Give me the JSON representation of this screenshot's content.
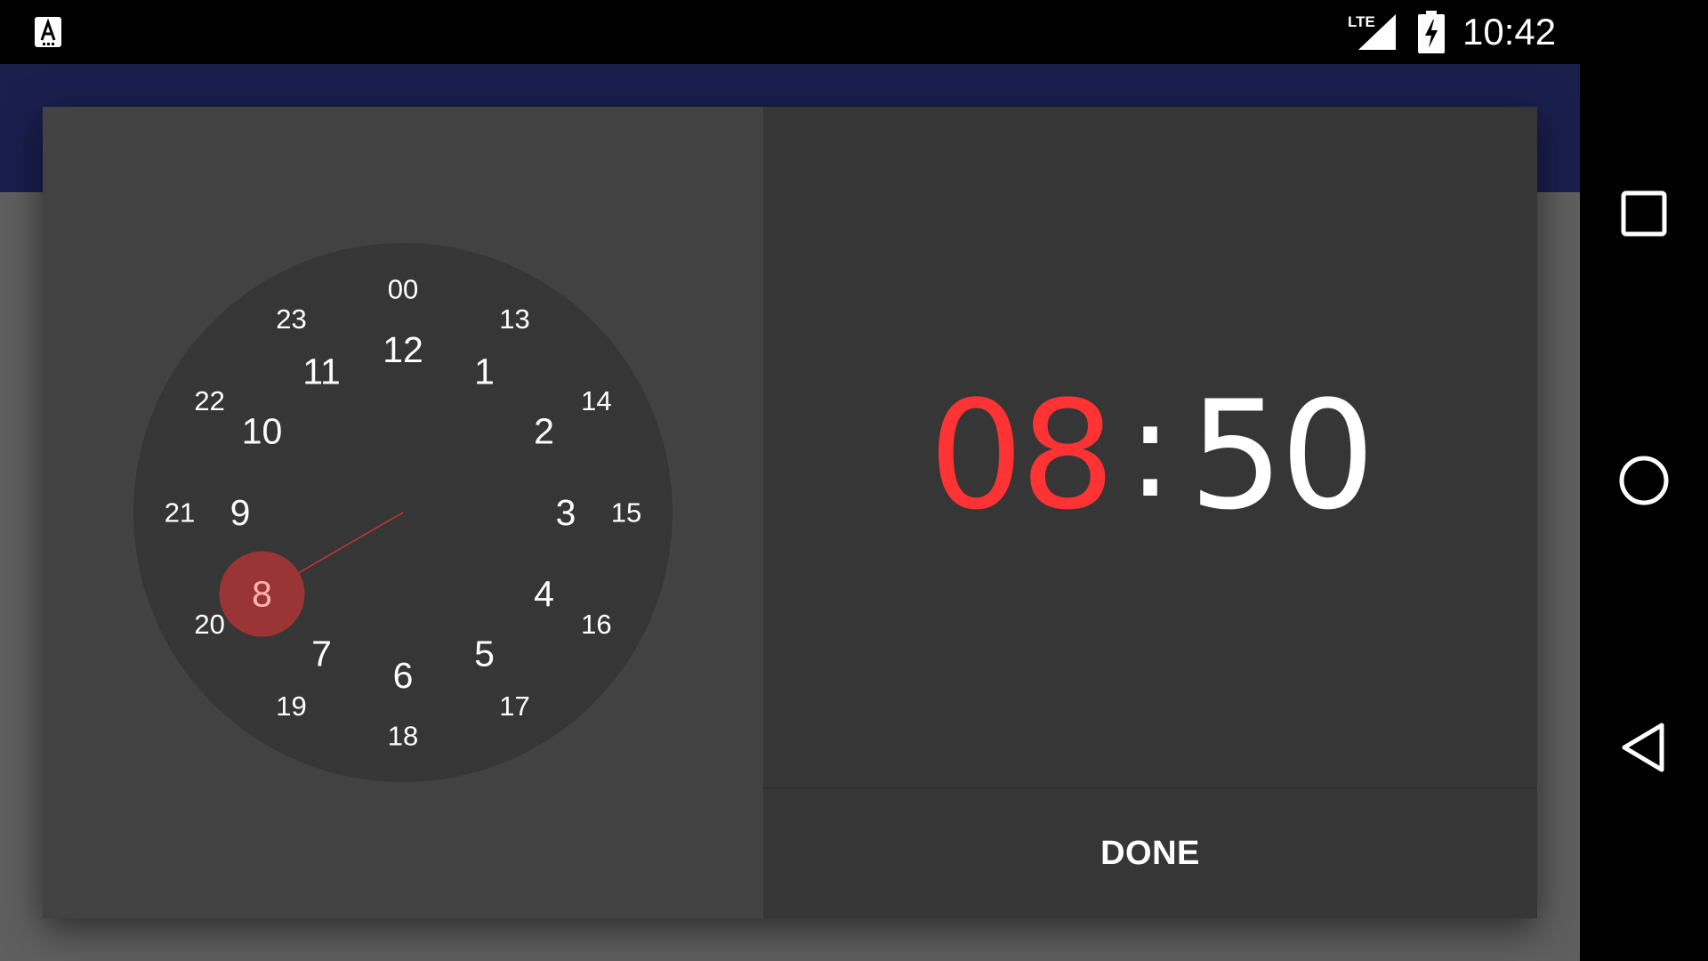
{
  "status_bar": {
    "time": "10:42",
    "network_label": "LTE",
    "notification_icon": "app-notification-icon",
    "battery_icon": "battery-charging-icon",
    "signal_icon": "cell-signal-icon"
  },
  "picker": {
    "hour": "08",
    "separator": ":",
    "minute": "50",
    "selected_hour": "8",
    "accent_color": "#ff3333",
    "done_label": "DONE",
    "outer_hours": [
      "00",
      "13",
      "14",
      "15",
      "16",
      "17",
      "18",
      "19",
      "20",
      "21",
      "22",
      "23"
    ],
    "inner_hours": [
      "12",
      "1",
      "2",
      "3",
      "4",
      "5",
      "6",
      "7",
      "8",
      "9",
      "10",
      "11"
    ]
  },
  "nav_bar": {
    "recents_icon": "recents-square-icon",
    "home_icon": "home-circle-icon",
    "back_icon": "back-triangle-icon"
  }
}
